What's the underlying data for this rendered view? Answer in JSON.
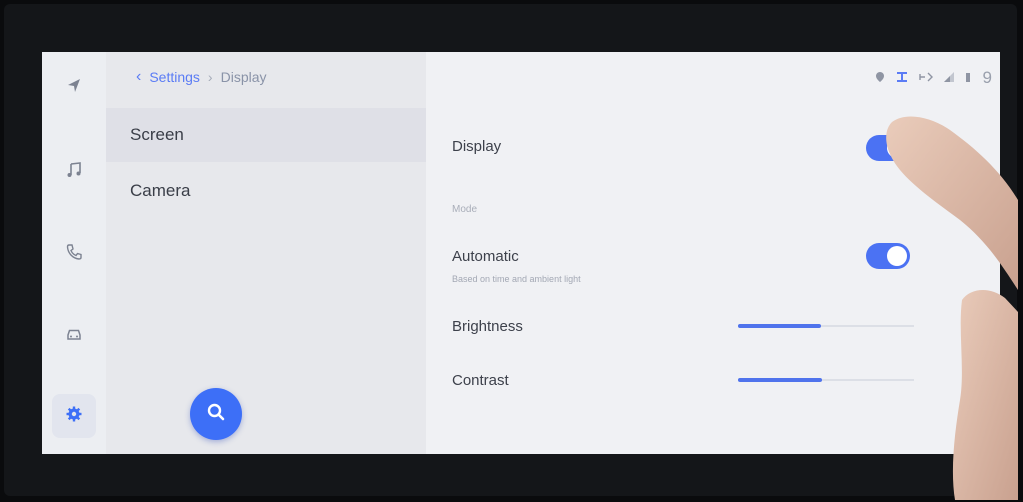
{
  "breadcrumb": {
    "back_icon": "chevron-left-icon",
    "parent": "Settings",
    "separator": "›",
    "current": "Display"
  },
  "rail": {
    "items": [
      {
        "name": "navigation",
        "icon": "navigation-arrow-icon",
        "active": false
      },
      {
        "name": "music",
        "icon": "music-note-icon",
        "active": false
      },
      {
        "name": "phone",
        "icon": "phone-icon",
        "active": false
      },
      {
        "name": "vehicle",
        "icon": "car-icon",
        "active": false
      },
      {
        "name": "settings",
        "icon": "gear-icon",
        "active": true
      }
    ]
  },
  "list": {
    "items": [
      {
        "label": "Screen",
        "selected": true
      },
      {
        "label": "Camera",
        "selected": false
      }
    ]
  },
  "search_fab": {
    "icon": "search-icon"
  },
  "status_bar": {
    "icons": [
      "location-icon",
      "sync-icon",
      "bluetooth-icon",
      "signal-icon",
      "signal-icon"
    ],
    "time": "9"
  },
  "settings": {
    "display": {
      "label": "Display",
      "on": true
    },
    "mode_section": "Mode",
    "automatic": {
      "label": "Automatic",
      "sublabel": "Based on time and ambient light",
      "on": true
    },
    "brightness": {
      "label": "Brightness",
      "value": 0.47
    },
    "contrast": {
      "label": "Contrast",
      "value": 0.48
    }
  },
  "colors": {
    "accent": "#4b72f3",
    "background": "#f0f1f4",
    "text": "#3d414b"
  }
}
